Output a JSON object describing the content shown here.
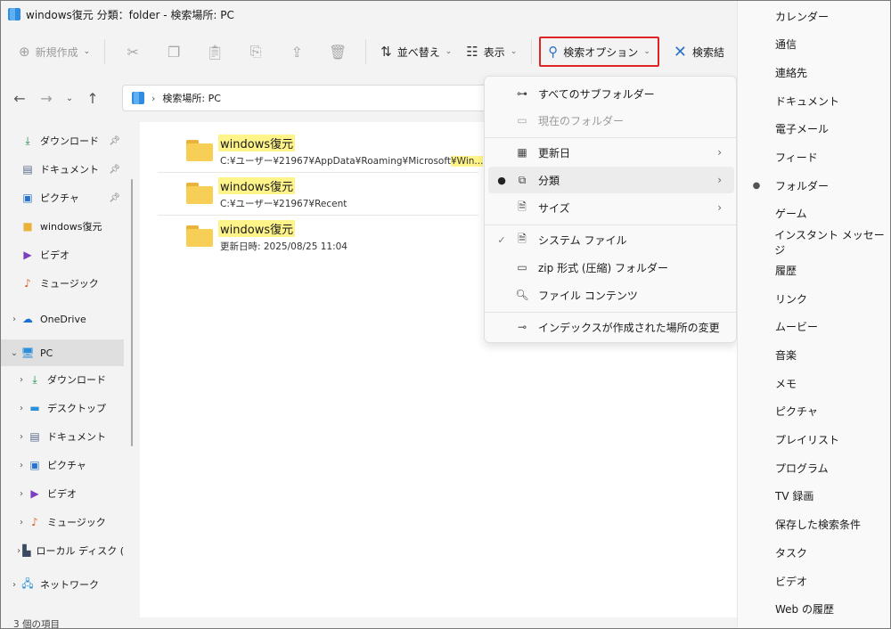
{
  "window": {
    "title": "windows復元 分類：folder - 検索場所: PC"
  },
  "toolbar": {
    "new_label": "新規作成",
    "sort_label": "並べ替え",
    "view_label": "表示",
    "search_options_label": "検索オプション",
    "close_search_label": "検索結"
  },
  "address": {
    "path": "検索場所: PC"
  },
  "sidebar": {
    "quick": [
      {
        "label": "ダウンロード",
        "icon": "download-icon",
        "pinned": true
      },
      {
        "label": "ドキュメント",
        "icon": "document-icon",
        "pinned": true
      },
      {
        "label": "ピクチャ",
        "icon": "picture-icon",
        "pinned": true
      },
      {
        "label": "windows復元",
        "icon": "folder-icon",
        "pinned": false
      },
      {
        "label": "ビデオ",
        "icon": "video-icon",
        "pinned": false
      },
      {
        "label": "ミュージック",
        "icon": "music-icon",
        "pinned": false
      }
    ],
    "onedrive": "OneDrive",
    "pc": "PC",
    "pc_children": [
      {
        "label": "ダウンロード",
        "icon": "download-icon"
      },
      {
        "label": "デスクトップ",
        "icon": "desktop-icon"
      },
      {
        "label": "ドキュメント",
        "icon": "document-icon"
      },
      {
        "label": "ピクチャ",
        "icon": "picture-icon"
      },
      {
        "label": "ビデオ",
        "icon": "video-icon"
      },
      {
        "label": "ミュージック",
        "icon": "music-icon"
      },
      {
        "label": "ローカル ディスク (",
        "icon": "disk-icon"
      }
    ],
    "network": "ネットワーク"
  },
  "files": [
    {
      "name": "windows復元",
      "sub_prefix": "C:¥ユーザー¥21967¥AppData¥Roaming¥Microsoft",
      "sub_hl": "¥Win..."
    },
    {
      "name": "windows復元",
      "sub_prefix": "C:¥ユーザー¥21967¥Recent",
      "sub_hl": ""
    },
    {
      "name": "windows復元",
      "sub_prefix": "更新日時: 2025/08/25 11:04",
      "sub_hl": ""
    }
  ],
  "menu": {
    "all_subfolders": "すべてのサブフォルダー",
    "current_folder": "現在のフォルダー",
    "date_modified": "更新日",
    "kind": "分類",
    "size": "サイズ",
    "system_files": "システム ファイル",
    "zip_folders": "zip 形式 (圧縮) フォルダー",
    "file_contents": "ファイル コンテンツ",
    "change_indexed": "インデックスが作成された場所の変更"
  },
  "submenu": {
    "items": [
      "カレンダー",
      "通信",
      "連絡先",
      "ドキュメント",
      "電子メール",
      "フィード",
      "フォルダー",
      "ゲーム",
      "インスタント メッセージ",
      "履歴",
      "リンク",
      "ムービー",
      "音楽",
      "メモ",
      "ピクチャ",
      "プレイリスト",
      "プログラム",
      "TV 録画",
      "保存した検索条件",
      "タスク",
      "ビデオ",
      "Web の履歴"
    ],
    "selected_index": 6
  },
  "status": {
    "count": "3 個の項目"
  },
  "colors": {
    "highlight_border": "#e02424",
    "search_highlight": "#fff48a",
    "folder": "#f8cf56"
  }
}
